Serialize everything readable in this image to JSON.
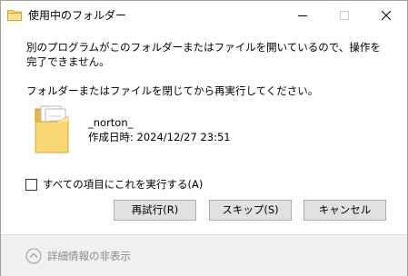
{
  "window": {
    "title": "使用中のフォルダー",
    "icon": "folder-icon",
    "controls": {
      "minimize_icon": "minimize-icon",
      "maximize_icon": "maximize-icon",
      "close_icon": "close-icon"
    }
  },
  "message": "別のプログラムがこのフォルダーまたはファイルを開いているので、操作を完了できません。",
  "instruction": "フォルダーまたはファイルを閉じてから再実行してください。",
  "item": {
    "icon": "folder-icon",
    "name": "_norton_",
    "created": "作成日時: 2024/12/27 23:51"
  },
  "checkbox": {
    "label": "すべての項目にこれを実行する(A)",
    "checked": false
  },
  "buttons": {
    "retry": "再試行(R)",
    "skip": "スキップ(S)",
    "cancel": "キャンセル"
  },
  "footer": {
    "details_label": "詳細情報の非表示",
    "details_icon": "chevron-up-icon"
  },
  "colors": {
    "button_bg": "#e1e1e1",
    "button_border": "#adadad",
    "footer_bg": "#f0f0f0",
    "disabled_text": "#8a8a8a",
    "folder_yellow": "#f8d775"
  }
}
